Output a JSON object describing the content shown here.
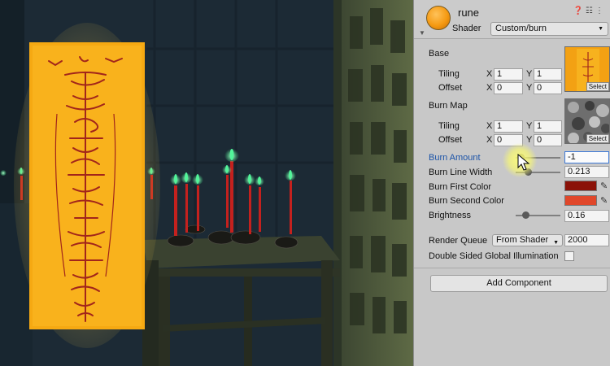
{
  "material": {
    "name": "rune",
    "icon": "material-sphere-icon",
    "header_icons": [
      "help-icon",
      "preset-icon",
      "menu-icon"
    ],
    "shader_label": "Shader",
    "shader_value": "Custom/burn"
  },
  "base": {
    "title": "Base",
    "tiling_label": "Tiling",
    "offset_label": "Offset",
    "x_label": "X",
    "y_label": "Y",
    "tiling_x": "1",
    "tiling_y": "1",
    "offset_x": "0",
    "offset_y": "0",
    "select_label": "Select"
  },
  "burn_map": {
    "title": "Burn Map",
    "tiling_label": "Tiling",
    "offset_label": "Offset",
    "x_label": "X",
    "y_label": "Y",
    "tiling_x": "1",
    "tiling_y": "1",
    "offset_x": "0",
    "offset_y": "0",
    "select_label": "Select"
  },
  "properties": {
    "burn_amount_label": "Burn Amount",
    "burn_amount_value": "-1",
    "burn_line_width_label": "Burn Line Width",
    "burn_line_width_value": "0.213",
    "burn_first_color_label": "Burn First Color",
    "burn_first_color": "#8b1208",
    "burn_second_color_label": "Burn Second Color",
    "burn_second_color": "#e0472a",
    "brightness_label": "Brightness",
    "brightness_value": "0.16"
  },
  "advanced": {
    "render_queue_label": "Render Queue",
    "render_queue_mode": "From Shader",
    "render_queue_value": "2000",
    "double_sided_gi_label": "Double Sided Global Illumination",
    "double_sided_gi_checked": false
  },
  "add_component_label": "Add Component",
  "colors": {
    "talisman": "#f6a912",
    "talisman_glow": "#ffd24a",
    "rune_ink": "#a2251b",
    "candle_flame": "#3cf08a",
    "candle_stick": "#c4211e"
  }
}
